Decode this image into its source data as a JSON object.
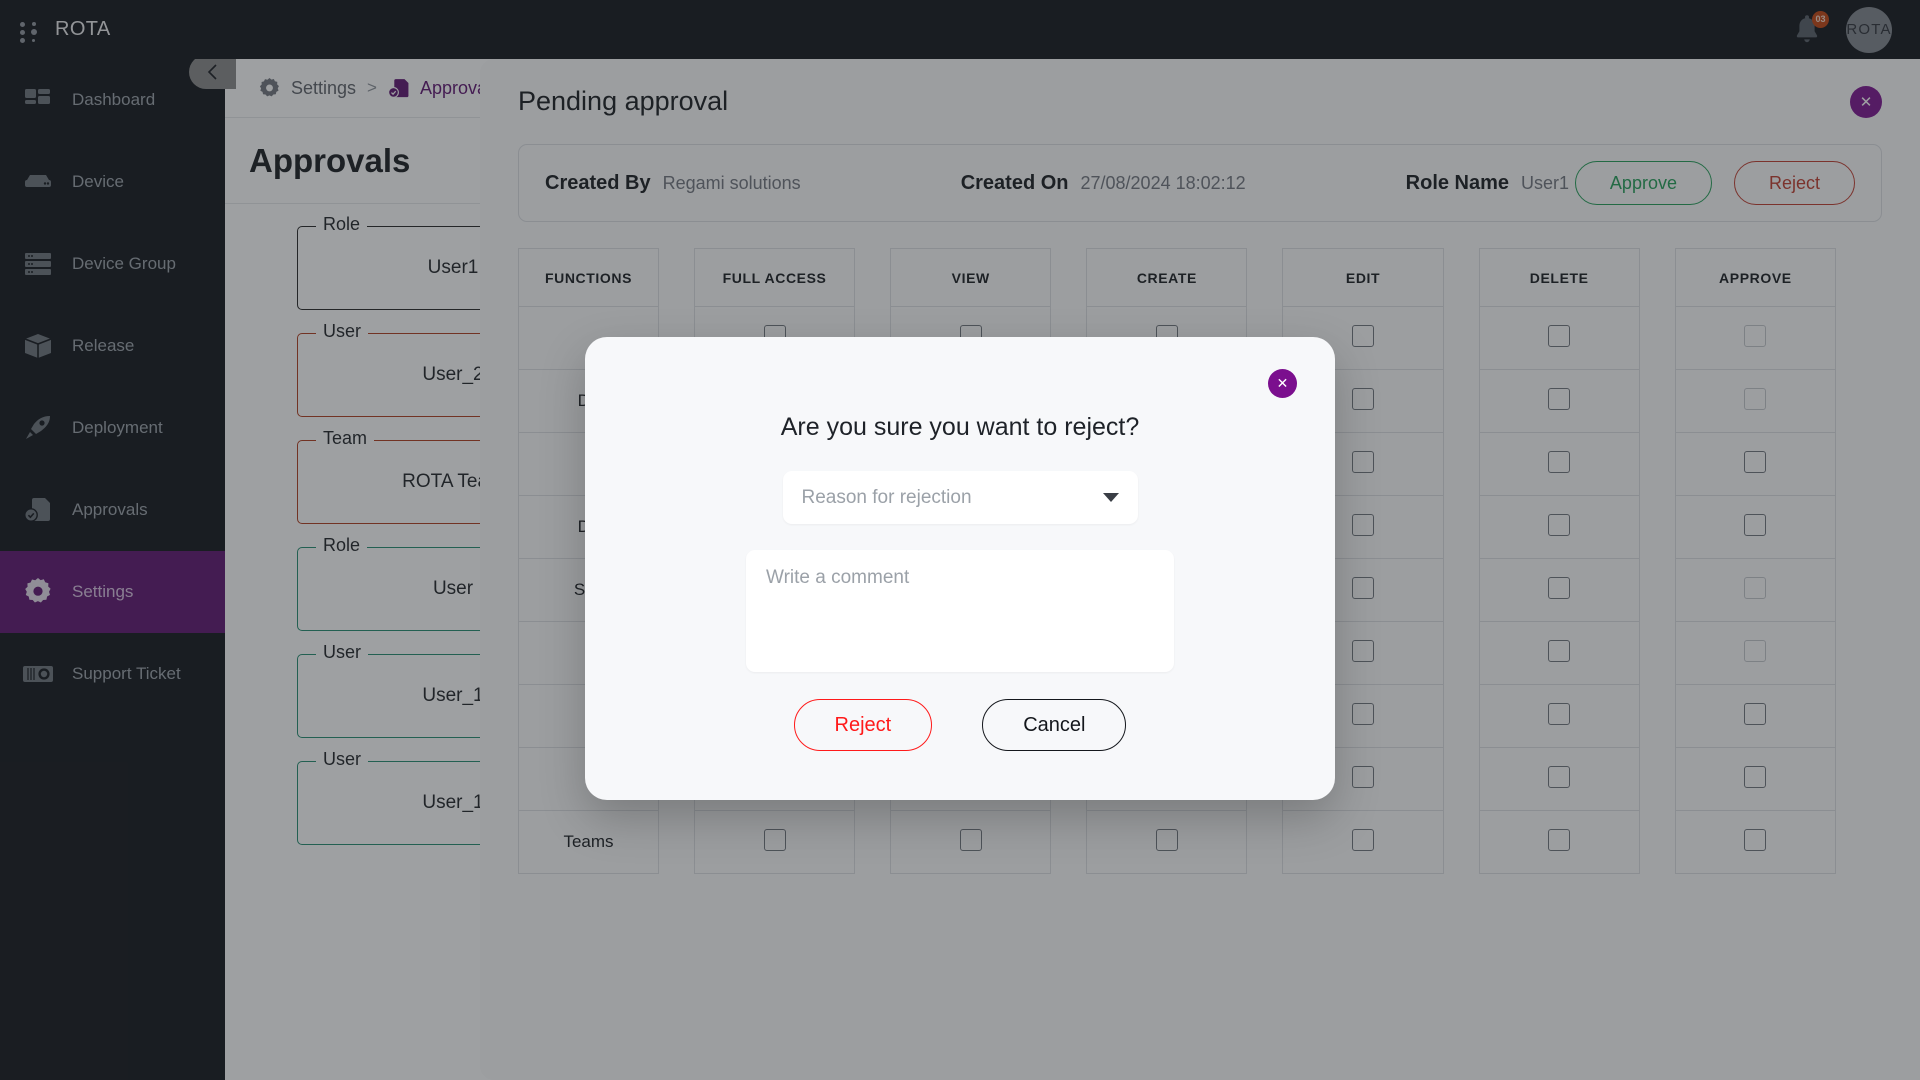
{
  "topbar": {
    "brand": "ROTA",
    "grip_icon": "grip-dots-icon",
    "bell_icon": "notification-bell-icon",
    "bell_badge": "03",
    "avatar_text": "ROTA"
  },
  "sidebar": {
    "collapse_icon": "chevron-left-icon",
    "items": [
      {
        "label": "Dashboard",
        "icon": "dashboard-icon",
        "active": false
      },
      {
        "label": "Device",
        "icon": "device-icon",
        "active": false
      },
      {
        "label": "Device Group",
        "icon": "device-group-icon",
        "active": false
      },
      {
        "label": "Release",
        "icon": "release-box-icon",
        "active": false
      },
      {
        "label": "Deployment",
        "icon": "rocket-icon",
        "active": false
      },
      {
        "label": "Approvals",
        "icon": "approvals-icon",
        "active": false
      },
      {
        "label": "Settings",
        "icon": "gear-icon",
        "active": true
      },
      {
        "label": "Support Ticket",
        "icon": "support-ticket-icon",
        "active": false
      }
    ]
  },
  "breadcrumb": {
    "root_icon": "gear-icon",
    "root": "Settings",
    "separator": ">",
    "current_icon": "approvals-icon",
    "current": "Approvals"
  },
  "page": {
    "title": "Approvals",
    "cards": [
      {
        "legend": "Role",
        "value": "User1",
        "color": "#222222"
      },
      {
        "legend": "User",
        "value": "User_2",
        "color": "#b03a1a"
      },
      {
        "legend": "Team",
        "value": "ROTA Team",
        "color": "#b03a1a"
      },
      {
        "legend": "Role",
        "value": "User",
        "color": "#1f8a6d"
      },
      {
        "legend": "User",
        "value": "User_1",
        "color": "#1f8a6d"
      },
      {
        "legend": "User",
        "value": "User_1",
        "color": "#1f8a6d"
      }
    ]
  },
  "drawer": {
    "title": "Pending approval",
    "close_icon": "close-icon",
    "meta": {
      "created_by_label": "Created By",
      "created_by_value": "Regami solutions",
      "created_on_label": "Created On",
      "created_on_value": "27/08/2024 18:02:12",
      "role_name_label": "Role Name",
      "role_name_value": "User1"
    },
    "approve_label": "Approve",
    "reject_label": "Reject",
    "approve_color": "#1f9d55",
    "reject_color": "#c0392b"
  },
  "table": {
    "headers": [
      "FUNCTIONS",
      "FULL ACCESS",
      "VIEW",
      "CREATE",
      "EDIT",
      "DELETE",
      "APPROVE"
    ],
    "rows": [
      {
        "function": "",
        "cells": [
          "on",
          "on",
          "on",
          "on",
          "on",
          "dim"
        ]
      },
      {
        "function": "De",
        "cells": [
          "on",
          "on",
          "on",
          "on",
          "on",
          "dim"
        ]
      },
      {
        "function": "",
        "cells": [
          "on",
          "on",
          "on",
          "on",
          "on",
          "on"
        ]
      },
      {
        "function": "De",
        "cells": [
          "on",
          "on",
          "on",
          "on",
          "on",
          "on"
        ]
      },
      {
        "function": "Sec",
        "cells": [
          "on",
          "on",
          "on",
          "on",
          "on",
          "dim"
        ]
      },
      {
        "function": "",
        "cells": [
          "on",
          "on",
          "on",
          "on",
          "on",
          "dim"
        ]
      },
      {
        "function": "",
        "cells": [
          "on",
          "on",
          "on",
          "on",
          "on",
          "on"
        ]
      },
      {
        "function": "",
        "cells": [
          "on",
          "on",
          "on",
          "on",
          "on",
          "on"
        ]
      },
      {
        "function": "Teams",
        "cells": [
          "on",
          "on",
          "on",
          "on",
          "on",
          "on"
        ]
      }
    ]
  },
  "modal": {
    "close_icon": "close-icon",
    "question": "Are you sure you want to reject?",
    "reason_placeholder": "Reason for rejection",
    "reason_value": "",
    "dropdown_icon": "chevron-down-icon",
    "comment_placeholder": "Write a comment",
    "comment_value": "",
    "reject_label": "Reject",
    "cancel_label": "Cancel",
    "reject_color": "#ff1a1a",
    "cancel_color": "#14171c",
    "accent_color": "#7b0f8e"
  }
}
